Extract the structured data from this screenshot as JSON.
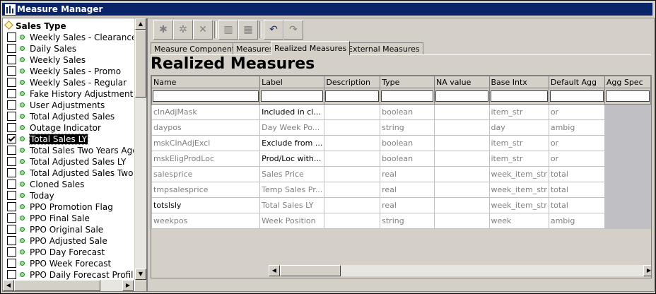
{
  "window": {
    "title": "Measure Manager"
  },
  "tree": {
    "root_label": "Sales Type",
    "items": [
      {
        "label": "Weekly Sales - Clearance",
        "checked": false
      },
      {
        "label": "Daily Sales",
        "checked": false
      },
      {
        "label": "Weekly Sales",
        "checked": false
      },
      {
        "label": "Weekly Sales - Promo",
        "checked": false
      },
      {
        "label": "Weekly Sales - Regular",
        "checked": false
      },
      {
        "label": "Fake History Adjustments",
        "checked": false
      },
      {
        "label": "User Adjustments",
        "checked": false
      },
      {
        "label": "Total Adjusted Sales",
        "checked": false
      },
      {
        "label": "Outage Indicator",
        "checked": false
      },
      {
        "label": "Total Sales LY",
        "checked": true
      },
      {
        "label": "Total Sales Two Years Ago",
        "checked": false
      },
      {
        "label": "Total Adjusted Sales LY",
        "checked": false
      },
      {
        "label": "Total Adjusted Sales Two",
        "checked": false
      },
      {
        "label": "Cloned Sales",
        "checked": false
      },
      {
        "label": "Today",
        "checked": false
      },
      {
        "label": "PPO Promotion Flag",
        "checked": false
      },
      {
        "label": "PPO Final Sale",
        "checked": false
      },
      {
        "label": "PPO Original Sale",
        "checked": false
      },
      {
        "label": "PPO Adjusted Sale",
        "checked": false
      },
      {
        "label": "PPO Day Forecast",
        "checked": false
      },
      {
        "label": "PPO Week Forecast",
        "checked": false
      },
      {
        "label": "PPO Daily Forecast Profile",
        "checked": false
      }
    ]
  },
  "toolbar": {
    "icons": [
      "add-measure-icon",
      "copy-measure-icon",
      "delete-icon",
      "chart-icon",
      "chart-edit-icon",
      "undo-icon",
      "redo-icon"
    ]
  },
  "tabs": [
    "Measure Components",
    "Measures",
    "Realized Measures",
    "External Measures"
  ],
  "active_tab": 2,
  "section_title": "Realized Measures",
  "grid": {
    "columns": [
      "Name",
      "Label",
      "Description",
      "Type",
      "NA value",
      "Base Intx",
      "Default Agg",
      "Agg Spec"
    ],
    "rows": [
      {
        "name": "clnAdjMask",
        "label": "Included in cl...",
        "description": "",
        "type": "boolean",
        "na": "",
        "base": "item_str",
        "agg": "or",
        "spec": "",
        "editable": true
      },
      {
        "name": "daypos",
        "label": "Day Week Po...",
        "description": "",
        "type": "string",
        "na": "",
        "base": "day",
        "agg": "ambig",
        "spec": "",
        "editable": false
      },
      {
        "name": "mskClnAdjExcl",
        "label": "Exclude from ...",
        "description": "",
        "type": "boolean",
        "na": "",
        "base": "item_str",
        "agg": "or",
        "spec": "",
        "editable": true
      },
      {
        "name": "mskEligProdLoc",
        "label": "Prod/Loc with...",
        "description": "",
        "type": "boolean",
        "na": "",
        "base": "item_str",
        "agg": "or",
        "spec": "",
        "editable": true
      },
      {
        "name": "salesprice",
        "label": "Sales Price",
        "description": "",
        "type": "real",
        "na": "",
        "base": "week_item_str",
        "agg": "total",
        "spec": "",
        "editable": false
      },
      {
        "name": "tmpsalesprice",
        "label": "Temp Sales Pr...",
        "description": "",
        "type": "real",
        "na": "",
        "base": "week_item_str",
        "agg": "total",
        "spec": "",
        "editable": false
      },
      {
        "name": "totslsly",
        "label": "Total Sales LY",
        "description": "",
        "type": "real",
        "na": "",
        "base": "week_item_str",
        "agg": "total",
        "spec": "",
        "editable": false,
        "name_black": true
      },
      {
        "name": "weekpos",
        "label": "Week Position",
        "description": "",
        "type": "string",
        "na": "",
        "base": "week",
        "agg": "ambig",
        "spec": "",
        "editable": false
      }
    ]
  }
}
